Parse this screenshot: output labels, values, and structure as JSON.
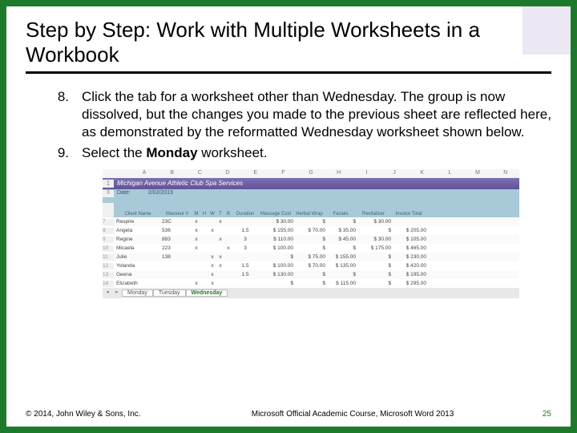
{
  "title": "Step by Step: Work with Multiple Worksheets in a Workbook",
  "steps": {
    "s8": {
      "num": "8.",
      "text_a": "Click the tab for a worksheet other than Wednesday. The group is now dissolved, but the changes you made to the previous sheet are reflected here, as demonstrated by the reformatted Wednesday worksheet shown below."
    },
    "s9": {
      "num": "9.",
      "text_a": "Select the ",
      "bold": "Monday",
      "text_b": " worksheet."
    }
  },
  "excel": {
    "cols": [
      "",
      "A",
      "B",
      "C",
      "D",
      "E",
      "F",
      "G",
      "H",
      "I",
      "J",
      "K",
      "L",
      "M",
      "N"
    ],
    "banner": "Michigan Avenue Athletic Club Spa Services",
    "date_label": "Date:",
    "date_value": "2/02/2013",
    "headers": [
      "",
      "Client Name",
      "Masseur #",
      "M",
      "H",
      "W",
      "T",
      "B",
      "Duration",
      "Massage Cost",
      "Herbal Wrap",
      "Facials",
      "Revitalizer",
      "Invoice Total"
    ],
    "rows": [
      {
        "r": "7",
        "name": "Respire",
        "mn": "23C",
        "m": "x",
        "h": "",
        "w": "",
        "t": "x",
        "b": "",
        "dur": "",
        "c1": "$ 30.00",
        "c2": "$",
        "c3": "$",
        "c4": "$ 30.00",
        "tot": ""
      },
      {
        "r": "8",
        "name": "Angela",
        "mn": "536",
        "m": "x",
        "h": "",
        "w": "x",
        "t": "",
        "b": "",
        "dur": "1.5",
        "c1": "$ 155.00",
        "c2": "$ 70.00",
        "c3": "$ 35.00",
        "c4": "$",
        "tot": "$ 205.00"
      },
      {
        "r": "9",
        "name": "Regine",
        "mn": "883",
        "m": "x",
        "h": "",
        "w": "",
        "t": "x",
        "b": "",
        "dur": "3",
        "c1": "$ 110.00",
        "c2": "$",
        "c3": "$ 45.00",
        "c4": "$ 30.00",
        "tot": "$ 105.00"
      },
      {
        "r": "10",
        "name": "Micaela",
        "mn": "223",
        "m": "x",
        "h": "",
        "w": "",
        "t": "",
        "b": "x",
        "dur": "3",
        "c1": "$ 100.00",
        "c2": "$",
        "c3": "$",
        "c4": "$ 175.00",
        "tot": "$ 465.00"
      },
      {
        "r": "11",
        "name": "Julie",
        "mn": "138",
        "m": "",
        "h": "",
        "w": "x",
        "t": "x",
        "b": "",
        "dur": "",
        "c1": "$",
        "c2": "$ 75.00",
        "c3": "$ 155.00",
        "c4": "$",
        "tot": "$ 230.00"
      },
      {
        "r": "12",
        "name": "Yolanda",
        "mn": "",
        "m": "",
        "h": "",
        "w": "x",
        "t": "x",
        "b": "",
        "dur": "1.5",
        "c1": "$ 100.00",
        "c2": "$ 70.00",
        "c3": "$ 135.00",
        "c4": "$",
        "tot": "$ 420.00"
      },
      {
        "r": "13",
        "name": "Geena",
        "mn": "",
        "m": "",
        "h": "",
        "w": "x",
        "t": "",
        "b": "",
        "dur": "1.5",
        "c1": "$ 130.00",
        "c2": "$",
        "c3": "$",
        "c4": "$",
        "tot": "$ 195.00"
      },
      {
        "r": "14",
        "name": "Elizabeth",
        "mn": "",
        "m": "x",
        "h": "",
        "w": "x",
        "t": "",
        "b": "",
        "dur": "",
        "c1": "$",
        "c2": "$",
        "c3": "$ 115.00",
        "c4": "$",
        "tot": "$ 295.00"
      }
    ],
    "tabs": [
      "Monday",
      "Tuesday",
      "Wednesday"
    ],
    "active_tab": 2
  },
  "footer": {
    "copyright": "© 2014, John Wiley & Sons, Inc.",
    "course": "Microsoft Official Academic Course, Microsoft Word 2013",
    "page": "25"
  }
}
